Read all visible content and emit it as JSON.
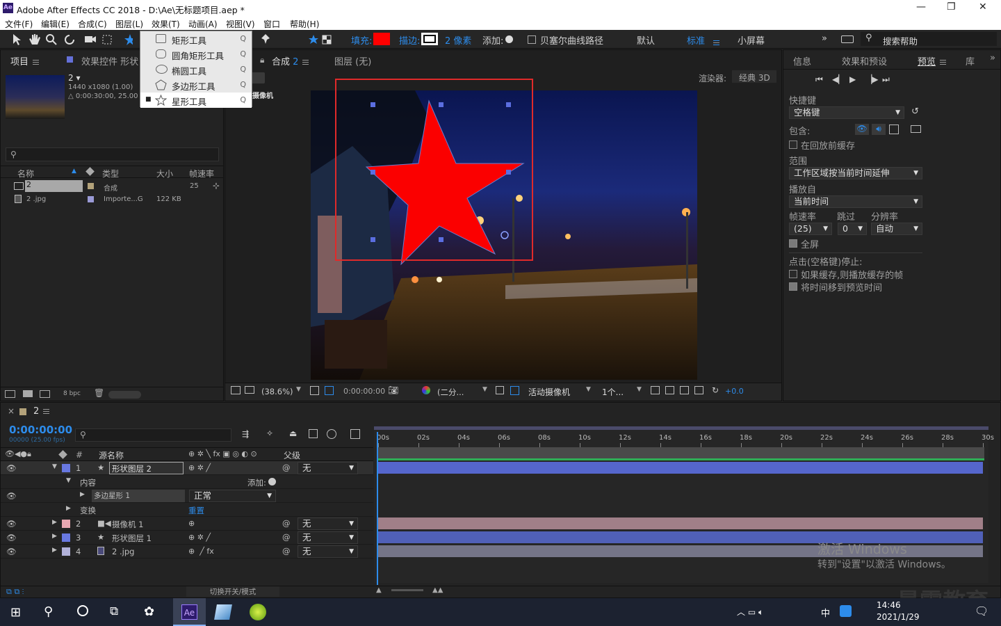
{
  "app": {
    "logo": "Ae",
    "title": "Adobe After Effects CC 2018 - D:\\Ae\\无标题项目.aep *"
  },
  "window_controls": {
    "min": "—",
    "max": "❐",
    "close": "✕"
  },
  "menu": [
    "文件(F)",
    "编辑(E)",
    "合成(C)",
    "图层(L)",
    "效果(T)",
    "动画(A)",
    "视图(V)",
    "窗口",
    "帮助(H)"
  ],
  "toolbar": {
    "fill_label": "填充:",
    "fill_color": "#ff0000",
    "stroke_label": "描边:",
    "stroke_px": "2 像素",
    "add_label": "添加:",
    "bezier": "贝塞尔曲线路径",
    "workspace_default": "默认",
    "workspace_standard": "标准",
    "workspace_small": "小屏幕",
    "search_help": "搜索帮助"
  },
  "shape_menu": [
    {
      "label": "矩形工具",
      "shortcut": "Q",
      "icon": "rect"
    },
    {
      "label": "圆角矩形工具",
      "shortcut": "Q",
      "icon": "rounded"
    },
    {
      "label": "椭圆工具",
      "shortcut": "Q",
      "icon": "ellipse"
    },
    {
      "label": "多边形工具",
      "shortcut": "Q",
      "icon": "polygon"
    },
    {
      "label": "星形工具",
      "shortcut": "Q",
      "icon": "star",
      "selected": true
    }
  ],
  "project": {
    "tab": "项目",
    "effects_tab": "效果控件 形状",
    "comp_name": "2",
    "comp_info1": "1440 x1080 (1.00)",
    "comp_info2": "△ 0:00:30:00, 25.00 fps",
    "columns": [
      "名称",
      "类型",
      "大小",
      "帧速率"
    ],
    "items": [
      {
        "name": "2",
        "type": "合成",
        "size": "",
        "fps": "25",
        "color": "#b3a27a"
      },
      {
        "name": "2 .jpg",
        "type": "Importe...G",
        "size": "122 KB",
        "fps": "",
        "color": "#9a9ad6"
      }
    ],
    "bpc": "8 bpc"
  },
  "comp": {
    "tab_label": "合成",
    "tab_name": "2",
    "layer_tab": "图层 (无)",
    "renderer_label": "渲染器:",
    "renderer": "经典 3D",
    "camera_label": "摄像机",
    "zoom": "(38.6%)",
    "time": "0:00:00:00",
    "resolution": "(二分...",
    "active_camera": "活动摄像机",
    "views": "1个...",
    "exposure": "+0.0"
  },
  "right_panel": {
    "tabs": [
      "信息",
      "效果和预设",
      "预览",
      "库"
    ],
    "shortcut_label": "快捷键",
    "shortcut": "空格键",
    "include_label": "包含:",
    "cache_before": "在回放前缓存",
    "range_label": "范围",
    "range": "工作区域按当前时间延伸",
    "play_from_label": "播放自",
    "play_from": "当前时间",
    "fps_label": "帧速率",
    "skip_label": "跳过",
    "res_label": "分辨率",
    "fps": "(25)",
    "skip": "0",
    "res": "自动",
    "fullscreen": "全屏",
    "stop_label": "点击(空格键)停止:",
    "if_cached": "如果缓存,则播放缓存的帧",
    "move_time": "将时间移到预览时间"
  },
  "timeline": {
    "comp_tab": "2",
    "timecode": "0:00:00:00",
    "timecode_sub": "00000 (25.00 fps)",
    "col_source": "源名称",
    "col_parent": "父级",
    "ruler": [
      "00s",
      "02s",
      "04s",
      "06s",
      "08s",
      "10s",
      "12s",
      "14s",
      "16s",
      "18s",
      "20s",
      "22s",
      "24s",
      "26s",
      "28s",
      "30s"
    ],
    "layers": [
      {
        "num": "1",
        "name": "形状图层 2",
        "color": "#6878e0",
        "parent": "无",
        "icon": "star"
      },
      {
        "num": "2",
        "name": "摄像机 1",
        "color": "#e8a6b0",
        "parent": "无",
        "icon": "camera"
      },
      {
        "num": "3",
        "name": "形状图层 1",
        "color": "#6878e0",
        "parent": "无",
        "icon": "star"
      },
      {
        "num": "4",
        "name": "2 .jpg",
        "color": "#b0b0d8",
        "parent": "无",
        "icon": "file"
      }
    ],
    "contents_label": "内容",
    "add_label": "添加:",
    "polystar": "多边星形 1",
    "blend": "正常",
    "transform": "变换",
    "reset": "重置",
    "switches": "切换开关/模式"
  },
  "watermark": {
    "line1": "激活 Windows",
    "line2": "转到\"设置\"以激活 Windows。",
    "brand": "最需教育"
  },
  "taskbar": {
    "time": "14:46",
    "date": "2021/1/29",
    "ime": "中"
  }
}
